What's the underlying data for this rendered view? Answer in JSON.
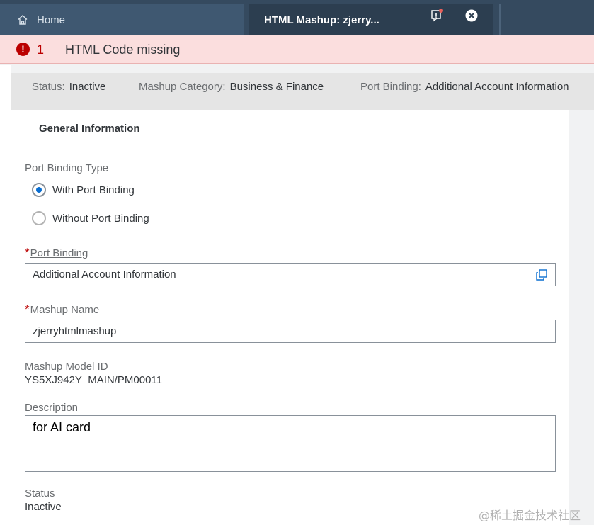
{
  "tabs": {
    "home_label": "Home",
    "active_label": "HTML Mashup: zjerry..."
  },
  "message_strip": {
    "count": "1",
    "text": "HTML Code missing",
    "icon_glyph": "!"
  },
  "header_attributes": [
    {
      "label": "Status:",
      "value": "Inactive"
    },
    {
      "label": "Mashup Category:",
      "value": "Business & Finance"
    },
    {
      "label": "Port Binding:",
      "value": "Additional Account Information"
    }
  ],
  "section": {
    "title": "General Information"
  },
  "form": {
    "port_binding_type": {
      "label": "Port Binding Type",
      "options": [
        "With Port Binding",
        "Without Port Binding"
      ],
      "selected": "With Port Binding"
    },
    "port_binding": {
      "required_marker": "*",
      "label": "Port Binding",
      "value": "Additional Account Information"
    },
    "mashup_name": {
      "required_marker": "*",
      "label": "Mashup Name",
      "value": "zjerryhtmlmashup"
    },
    "mashup_model_id": {
      "label": "Mashup Model ID",
      "value": "YS5XJ942Y_MAIN/PM00011"
    },
    "description": {
      "label": "Description",
      "value": "for AI card"
    },
    "status": {
      "label": "Status",
      "value": "Inactive"
    }
  },
  "watermark": "@稀土掘金技术社区",
  "colors": {
    "shell_bar": "#354a5f",
    "error": "#bb0000",
    "message_background": "#fbdede",
    "radio_selected": "#0a6ed1"
  }
}
